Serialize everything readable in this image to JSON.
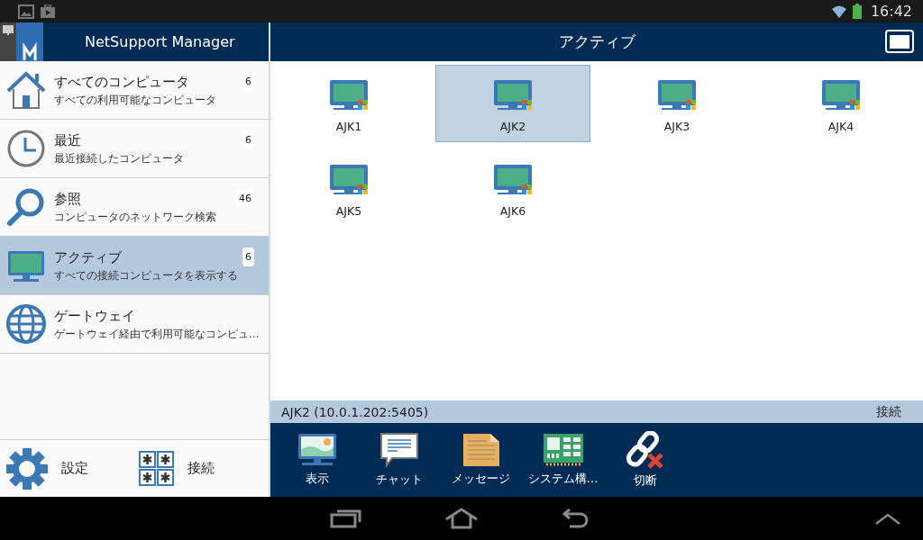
{
  "status_bar": {
    "time": "16:42"
  },
  "app": {
    "title": "NetSupport Manager"
  },
  "sidebar": {
    "items": [
      {
        "kind": "home",
        "title": "すべてのコンピュータ",
        "subtitle": "すべての利用可能なコンピュータ",
        "count": "6",
        "selected": false
      },
      {
        "kind": "clock",
        "title": "最近",
        "subtitle": "最近接続したコンピュータ",
        "count": "6",
        "selected": false
      },
      {
        "kind": "search",
        "title": "参照",
        "subtitle": "コンピュータのネットワーク検索",
        "count": "46",
        "selected": false
      },
      {
        "kind": "monitor",
        "title": "アクティブ",
        "subtitle": "すべての接続コンピュータを表示する",
        "count": "6",
        "selected": true
      },
      {
        "kind": "globe",
        "title": "ゲートウェイ",
        "subtitle": "ゲートウェイ経由で利用可能なコンピュ…",
        "selected": false
      }
    ],
    "footer": [
      {
        "kind": "gear",
        "label": "設定"
      },
      {
        "kind": "grid",
        "label": "接続"
      }
    ]
  },
  "main": {
    "title": "アクティブ",
    "computers": [
      {
        "name": "AJK1",
        "selected": false
      },
      {
        "name": "AJK2",
        "selected": true
      },
      {
        "name": "AJK3",
        "selected": false
      },
      {
        "name": "AJK4",
        "selected": false
      },
      {
        "name": "AJK5",
        "selected": false
      },
      {
        "name": "AJK6",
        "selected": false
      }
    ],
    "info": {
      "selection": "AJK2 (10.0.1.202:5405)",
      "state": "接続"
    },
    "toolbar": [
      {
        "kind": "view",
        "label": "表示"
      },
      {
        "kind": "chat",
        "label": "チャット"
      },
      {
        "kind": "message",
        "label": "メッセージ"
      },
      {
        "kind": "system",
        "label": "システム構…"
      },
      {
        "kind": "disconnect",
        "label": "切断"
      }
    ]
  }
}
